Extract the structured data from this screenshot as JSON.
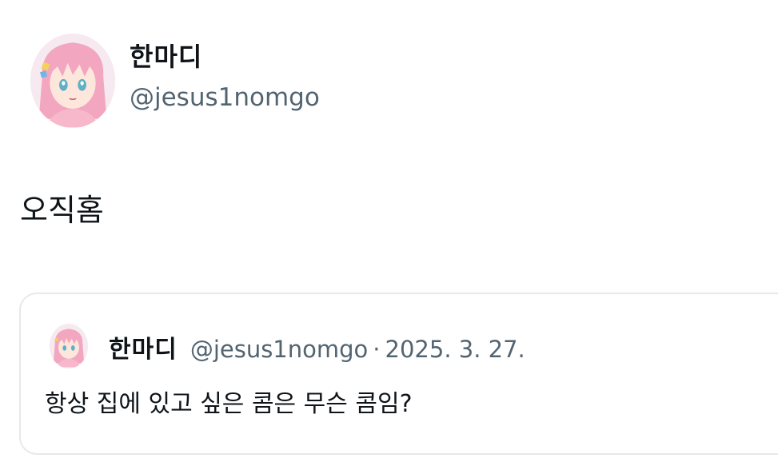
{
  "author": {
    "display_name": "한마디",
    "handle": "@jesus1nomgo",
    "avatar_icon": "pink-haired-anime-girl-avatar-icon"
  },
  "tweet": {
    "text": "오직홈"
  },
  "quoted_tweet": {
    "display_name": "한마디",
    "handle": "@jesus1nomgo",
    "separator": "·",
    "date": "2025. 3. 27.",
    "text": "항상 집에 있고 싶은 콤은 무슨 콤임?",
    "avatar_icon": "pink-haired-anime-girl-avatar-icon"
  },
  "colors": {
    "text_primary": "#0f1419",
    "text_secondary": "#536471",
    "border": "#e6e9ec",
    "avatar_hair": "#f2a6c0",
    "avatar_bg": "#f6e9ef"
  }
}
